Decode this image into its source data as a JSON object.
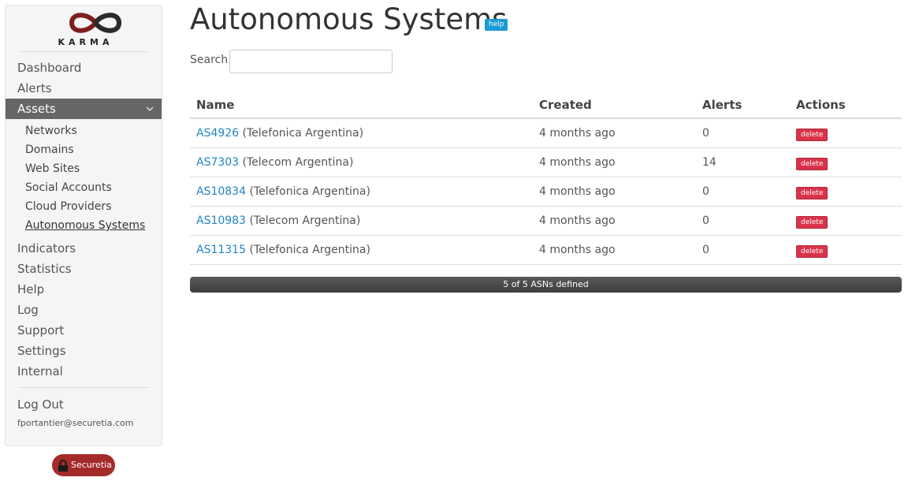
{
  "app": {
    "logo_text": "KARMA",
    "brand_badge": "Securetia"
  },
  "sidebar": {
    "items_top": [
      {
        "label": "Dashboard"
      },
      {
        "label": "Alerts"
      }
    ],
    "active": {
      "label": "Assets",
      "icon": "chevron-down-icon"
    },
    "sub_items": [
      {
        "label": "Networks"
      },
      {
        "label": "Domains"
      },
      {
        "label": "Web Sites"
      },
      {
        "label": "Social Accounts"
      },
      {
        "label": "Cloud Providers"
      },
      {
        "label": "Autonomous Systems"
      }
    ],
    "items_bottom": [
      {
        "label": "Indicators"
      },
      {
        "label": "Statistics"
      },
      {
        "label": "Help"
      },
      {
        "label": "Log"
      },
      {
        "label": "Support"
      },
      {
        "label": "Settings"
      },
      {
        "label": "Internal"
      }
    ],
    "logout_label": "Log Out",
    "user_email": "fportantier@securetia.com"
  },
  "main": {
    "title": "Autonomous Systems",
    "help_label": "help",
    "search_label": "Search:",
    "search_value": "",
    "columns": [
      "Name",
      "Created",
      "Alerts",
      "Actions"
    ],
    "rows": [
      {
        "asn": "AS4926",
        "org": "(Telefonica Argentina)",
        "created": "4 months ago",
        "alerts": "0",
        "action": "delete"
      },
      {
        "asn": "AS7303",
        "org": "(Telecom Argentina)",
        "created": "4 months ago",
        "alerts": "14",
        "action": "delete"
      },
      {
        "asn": "AS10834",
        "org": "(Telefonica Argentina)",
        "created": "4 months ago",
        "alerts": "0",
        "action": "delete"
      },
      {
        "asn": "AS10983",
        "org": "(Telecom Argentina)",
        "created": "4 months ago",
        "alerts": "0",
        "action": "delete"
      },
      {
        "asn": "AS11315",
        "org": "(Telefonica Argentina)",
        "created": "4 months ago",
        "alerts": "0",
        "action": "delete"
      }
    ],
    "status_text": "5 of 5 ASNs defined"
  },
  "colors": {
    "accent_link": "#2384c6",
    "help_badge": "#1b9ad5",
    "delete_button": "#d9334a",
    "active_nav": "#666666",
    "brand": "#a52a2a"
  }
}
